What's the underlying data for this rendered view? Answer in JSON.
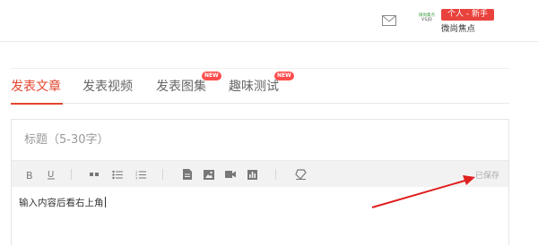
{
  "header": {
    "logo_top": "微尚集点",
    "logo_bottom": "VSJD",
    "user_badge": "个人 - 新手",
    "user_name": "微尚焦点"
  },
  "tabs": [
    {
      "label": "发表文章",
      "active": true,
      "new": false
    },
    {
      "label": "发表视频",
      "active": false,
      "new": false
    },
    {
      "label": "发表图集",
      "active": false,
      "new": true
    },
    {
      "label": "趣味测试",
      "active": false,
      "new": true
    }
  ],
  "new_badge_text": "NEW",
  "editor": {
    "title_placeholder": "标题（5-30字）",
    "save_status": "已保存",
    "content_text": "输入内容后看右上角"
  },
  "icons": [
    "mail-icon",
    "bold-icon",
    "underline-icon",
    "quote-icon",
    "bullet-list-icon",
    "numbered-list-icon",
    "document-icon",
    "image-icon",
    "video-icon",
    "chart-icon",
    "clear-format-icon"
  ],
  "colors": {
    "accent": "#e2472f",
    "badge": "#e9423c",
    "arrow": "#e02020",
    "toolbar_bg": "#f2f2f2"
  }
}
